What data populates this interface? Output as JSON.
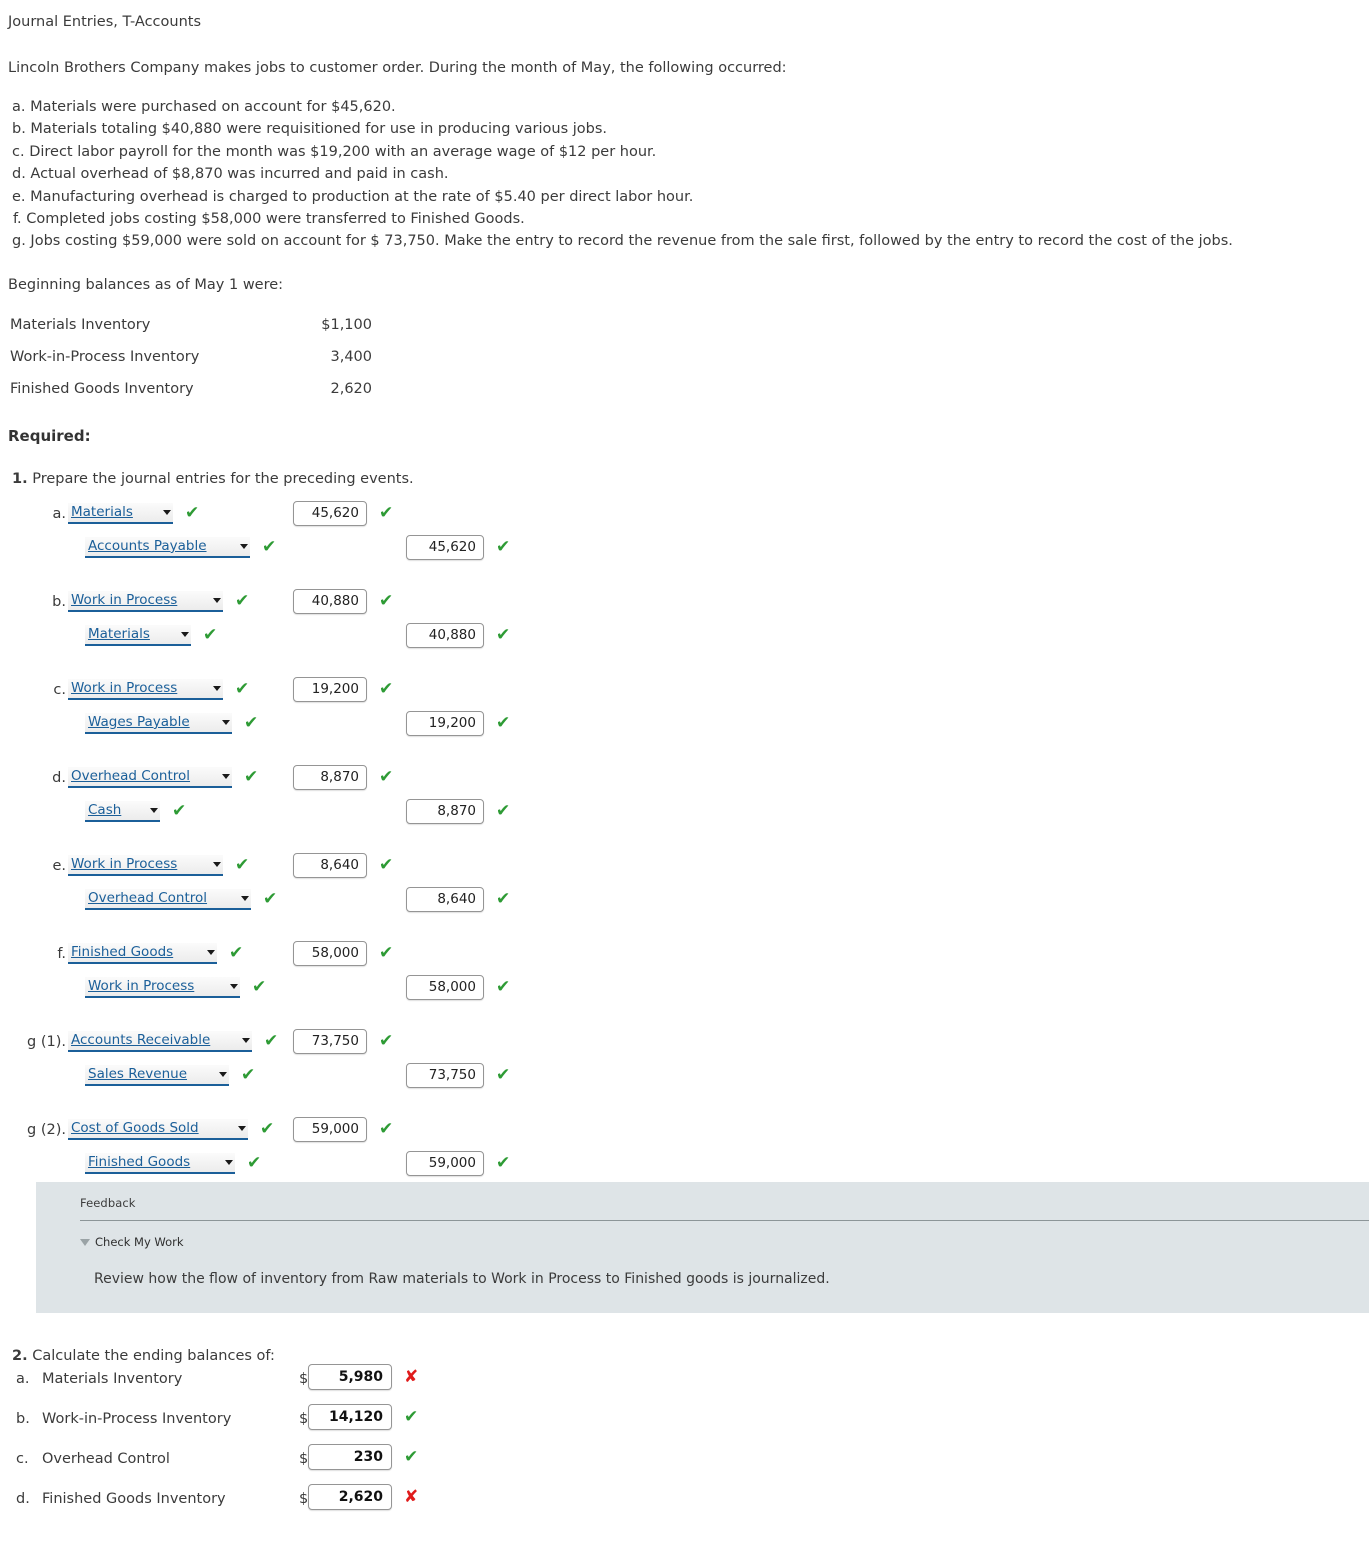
{
  "page": {
    "title": "Journal Entries, T-Accounts",
    "intro": "Lincoln Brothers Company makes jobs to customer order. During the month of May, the following occurred:",
    "facts": [
      "a. Materials were purchased on account for $45,620.",
      "b. Materials totaling $40,880 were requisitioned for use in producing various jobs.",
      "c. Direct labor payroll for the month was $19,200 with an average wage of $12 per hour.",
      "d. Actual overhead of $8,870 was incurred and paid in cash.",
      "e. Manufacturing overhead is charged to production at the rate of $5.40 per direct labor hour.",
      "f. Completed jobs costing $58,000 were transferred to Finished Goods.",
      "g. Jobs costing $59,000 were sold on account for $ 73,750. Make the entry to record the revenue from the sale first, followed by the entry to record the cost of the jobs."
    ],
    "beginning_line": "Beginning balances as of May 1 were:",
    "beginning_balances": [
      {
        "label": "Materials Inventory",
        "amount": "$1,100"
      },
      {
        "label": "Work-in-Process Inventory",
        "amount": "3,400"
      },
      {
        "label": "Finished Goods Inventory",
        "amount": "2,620"
      }
    ],
    "required_label": "Required:"
  },
  "part1": {
    "number": "1.",
    "heading": "Prepare the journal entries for the preceding events.",
    "entries": [
      {
        "ref": "a.",
        "debit": {
          "account": "Materials",
          "account_width": 105,
          "amount": "45,620",
          "account_mark": "check",
          "amount_mark": "check"
        },
        "credit": {
          "account": "Accounts Payable",
          "account_width": 165,
          "amount": "45,620",
          "account_mark": "check",
          "amount_mark": "check"
        }
      },
      {
        "ref": "b.",
        "debit": {
          "account": "Work in Process",
          "account_width": 155,
          "amount": "40,880",
          "account_mark": "check",
          "amount_mark": "check"
        },
        "credit": {
          "account": "Materials",
          "account_width": 106,
          "amount": "40,880",
          "account_mark": "check",
          "amount_mark": "check"
        }
      },
      {
        "ref": "c.",
        "debit": {
          "account": "Work in Process",
          "account_width": 155,
          "amount": "19,200",
          "account_mark": "check",
          "amount_mark": "check"
        },
        "credit": {
          "account": "Wages Payable",
          "account_width": 147,
          "amount": "19,200",
          "account_mark": "check",
          "amount_mark": "check"
        }
      },
      {
        "ref": "d.",
        "debit": {
          "account": "Overhead Control",
          "account_width": 164,
          "amount": "8,870",
          "account_mark": "check",
          "amount_mark": "check"
        },
        "credit": {
          "account": "Cash",
          "account_width": 75,
          "amount": "8,870",
          "account_mark": "check",
          "amount_mark": "check"
        }
      },
      {
        "ref": "e.",
        "debit": {
          "account": "Work in Process",
          "account_width": 155,
          "amount": "8,640",
          "account_mark": "check",
          "amount_mark": "check"
        },
        "credit": {
          "account": "Overhead Control",
          "account_width": 166,
          "amount": "8,640",
          "account_mark": "check",
          "amount_mark": "check"
        }
      },
      {
        "ref": "f.",
        "debit": {
          "account": "Finished Goods",
          "account_width": 149,
          "amount": "58,000",
          "account_mark": "check",
          "amount_mark": "check"
        },
        "credit": {
          "account": "Work in Process",
          "account_width": 155,
          "amount": "58,000",
          "account_mark": "check",
          "amount_mark": "check"
        }
      },
      {
        "ref": "g (1).",
        "debit": {
          "account": "Accounts Receivable",
          "account_width": 184,
          "amount": "73,750",
          "account_mark": "check",
          "amount_mark": "check"
        },
        "credit": {
          "account": "Sales Revenue",
          "account_width": 144,
          "amount": "73,750",
          "account_mark": "check",
          "amount_mark": "check"
        }
      },
      {
        "ref": "g (2).",
        "debit": {
          "account": "Cost of Goods Sold",
          "account_width": 180,
          "amount": "59,000",
          "account_mark": "check",
          "amount_mark": "check"
        },
        "credit": {
          "account": "Finished Goods",
          "account_width": 150,
          "amount": "59,000",
          "account_mark": "check",
          "amount_mark": "check"
        }
      }
    ]
  },
  "feedback": {
    "title": "Feedback",
    "check_my_work": "Check My Work",
    "body": "Review how the flow of inventory from Raw materials to Work in Process to Finished goods is journalized."
  },
  "part2": {
    "number": "2.",
    "heading": "Calculate the ending balances of:",
    "dollar": "$",
    "rows": [
      {
        "ref": "a.",
        "label": "Materials Inventory",
        "value": "5,980",
        "mark": "cross"
      },
      {
        "ref": "b.",
        "label": "Work-in-Process Inventory",
        "value": "14,120",
        "mark": "check"
      },
      {
        "ref": "c.",
        "label": "Overhead Control",
        "value": "230",
        "mark": "check"
      },
      {
        "ref": "d.",
        "label": "Finished Goods Inventory",
        "value": "2,620",
        "mark": "cross"
      }
    ]
  },
  "icons": {
    "check": "✔",
    "cross": "✘",
    "caret_down": "caret-down-icon"
  },
  "colors": {
    "check_green": "#2e9b35",
    "cross_red": "#e01b1b",
    "link_blue": "#1b5f99",
    "feedback_bg": "#dee4e7"
  }
}
